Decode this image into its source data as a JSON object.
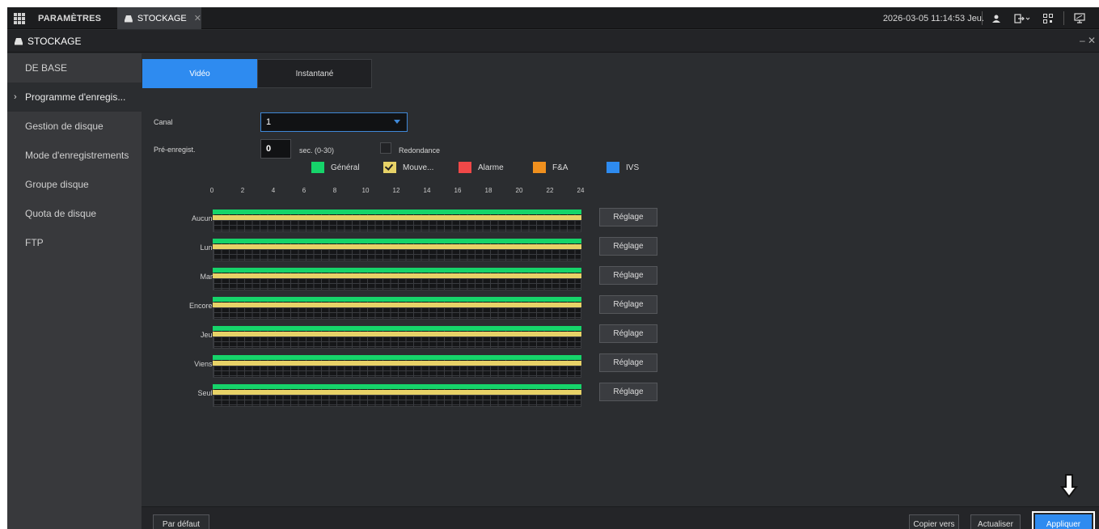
{
  "topbar": {
    "settings_tab": "PARAMÈTRES",
    "storage_tab": "STOCKAGE",
    "datetime": "2026-03-05 11:14:53 Jeu."
  },
  "window": {
    "title": "STOCKAGE"
  },
  "sidebar": {
    "items": [
      {
        "label": "DE BASE"
      },
      {
        "label": "Programme d'enregis..."
      },
      {
        "label": "Gestion de disque"
      },
      {
        "label": "Mode d'enregistrements"
      },
      {
        "label": "Groupe disque"
      },
      {
        "label": "Quota de disque"
      },
      {
        "label": "FTP"
      }
    ]
  },
  "tabs": {
    "video": "Vidéo",
    "snapshot": "Instantané"
  },
  "form": {
    "channel_label": "Canal",
    "channel_value": "1",
    "prerecord_label": "Pré-enregist.",
    "prerecord_value": "0",
    "prerecord_unit": "sec. (0-30)",
    "redundancy_label": "Redondance"
  },
  "legend": {
    "general": "Général",
    "motion": "Mouve...",
    "alarm": "Alarme",
    "fa": "F&A",
    "ivs": "IVS",
    "colors": {
      "general": "#16d46a",
      "motion": "#e7d267",
      "alarm": "#f04848",
      "fa": "#f0901e",
      "ivs": "#2e8bf0"
    }
  },
  "schedule": {
    "hours": [
      "0",
      "2",
      "4",
      "6",
      "8",
      "10",
      "12",
      "14",
      "16",
      "18",
      "20",
      "22",
      "24"
    ],
    "days": [
      "Aucun.",
      "Lun.",
      "Mar.",
      "Encore.",
      "Jeu.",
      "Viens.",
      "Seul."
    ],
    "button_label": "Réglage"
  },
  "footer": {
    "default_btn": "Par défaut",
    "copy_btn": "Copier vers",
    "refresh_btn": "Actualiser",
    "apply_btn": "Appliquer"
  }
}
